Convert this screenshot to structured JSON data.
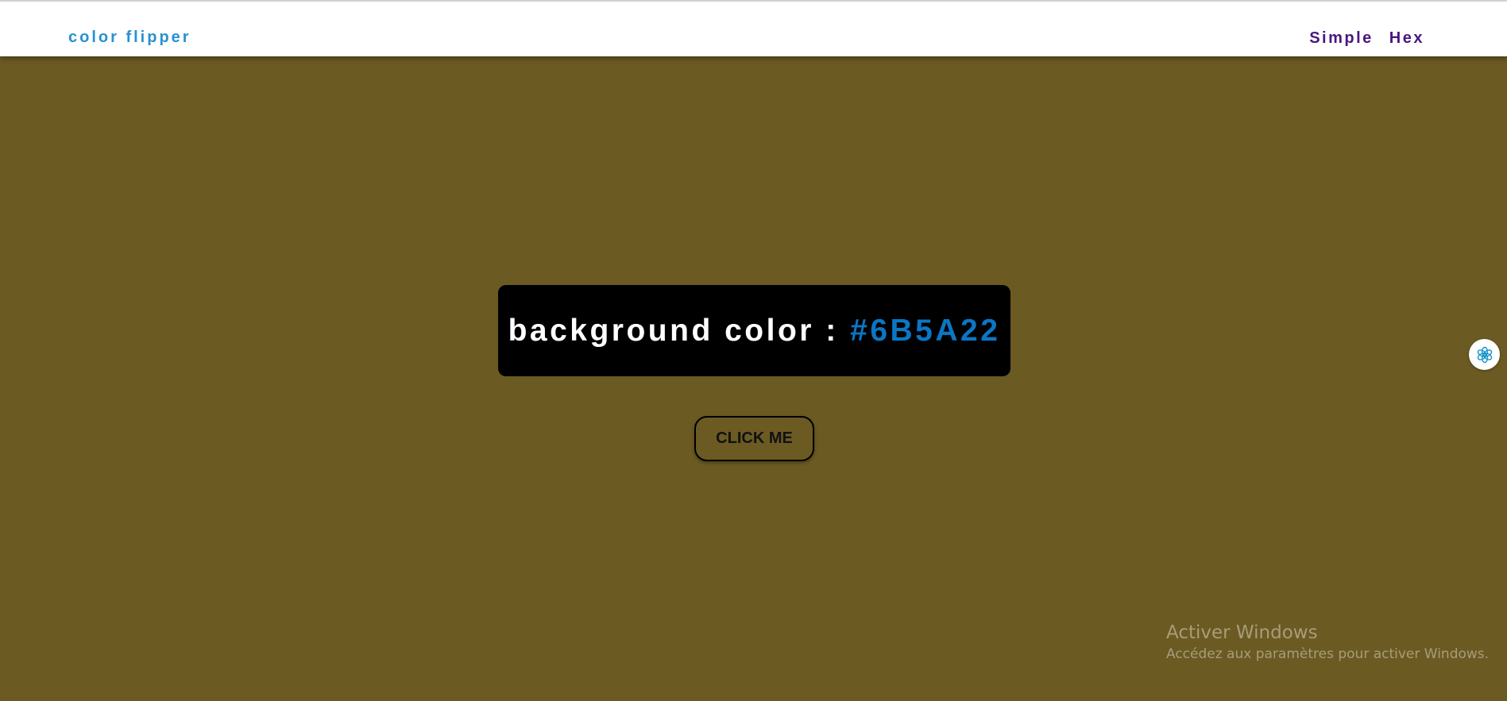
{
  "navbar": {
    "brand": "color flipper",
    "links": [
      {
        "label": "Simple"
      },
      {
        "label": "Hex"
      }
    ]
  },
  "display": {
    "label": "background color : ",
    "value": "#6B5A22"
  },
  "button": {
    "label": "CLICK ME"
  },
  "side_widget": {
    "icon": "openai-icon"
  },
  "watermark": {
    "title": "Activer Windows",
    "subtitle": "Accédez aux paramètres pour activer Windows."
  },
  "colors": {
    "background": "#6B5A22",
    "brand": "#2891d0",
    "nav_link": "#4a1680",
    "value_text": "#0a76c6",
    "box": "#000000"
  }
}
